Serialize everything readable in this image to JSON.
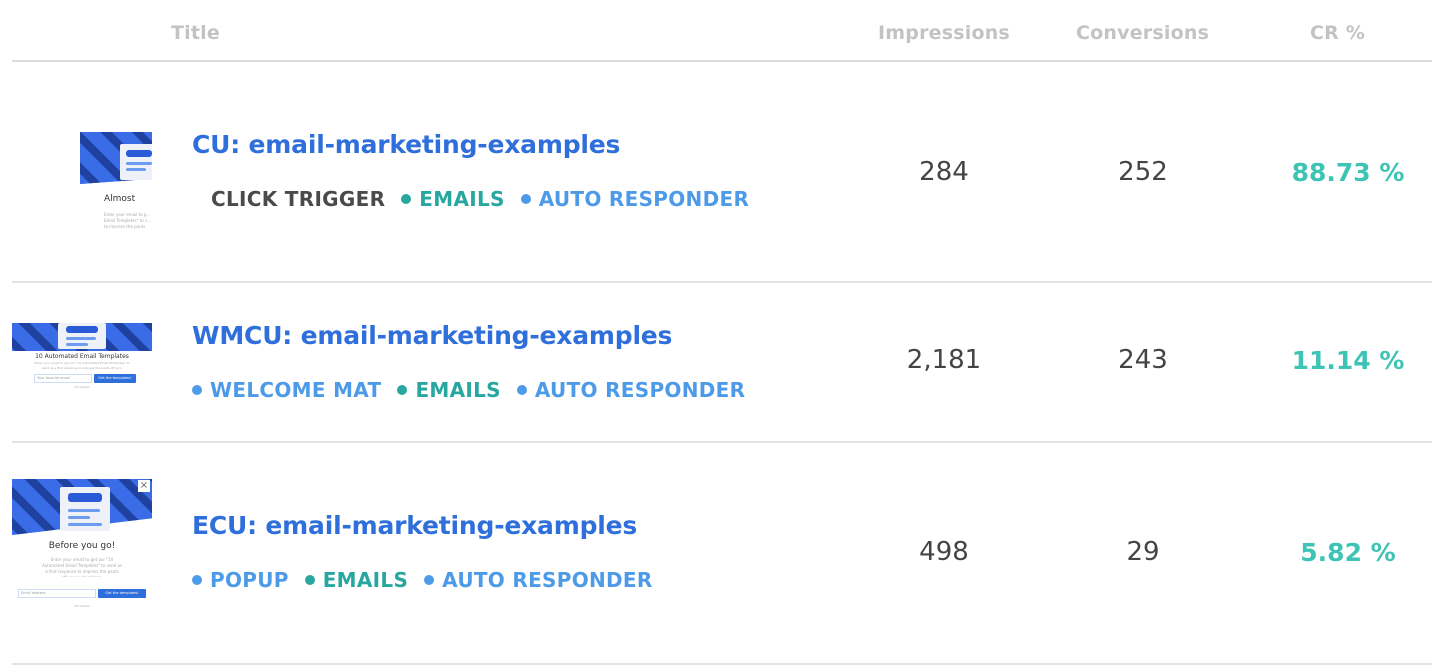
{
  "columns": {
    "title": "Title",
    "impressions": "Impressions",
    "conversions": "Conversions",
    "cr": "CR %"
  },
  "colors": {
    "title_link": "#2f6fdb",
    "tag_blue": "#4d9be8",
    "tag_teal": "#27a7a0",
    "tag_plain": "#4a4a4a",
    "cr_value": "#3ec4b4",
    "header_text": "#c3c3c3"
  },
  "rows": [
    {
      "title": "CU: email-marketing-examples",
      "tags": [
        {
          "label": "CLICK TRIGGER",
          "style": "plain",
          "dot": false
        },
        {
          "label": "EMAILS",
          "style": "teal",
          "dot": true
        },
        {
          "label": "AUTO RESPONDER",
          "style": "blue",
          "dot": true
        }
      ],
      "impressions": "284",
      "conversions": "252",
      "cr": "88.73 %",
      "thumbnail": {
        "icon": "campaign-preview-thumbnail",
        "heading": "Almost",
        "body": "Enter your email to g... Email Templates\" to s... to impress the pants"
      }
    },
    {
      "title": "WMCU: email-marketing-examples",
      "tags": [
        {
          "label": "WELCOME MAT",
          "style": "blue",
          "dot": true
        },
        {
          "label": "EMAILS",
          "style": "teal",
          "dot": true
        },
        {
          "label": "AUTO RESPONDER",
          "style": "blue",
          "dot": true
        }
      ],
      "impressions": "2,181",
      "conversions": "243",
      "cr": "11.14 %",
      "thumbnail": {
        "icon": "campaign-preview-thumbnail",
        "heading": "10 Automated Email Templates",
        "body": "Enter your email to get our \"10 Automated Email Templates\" to send as a first response to impress the pants off your subscribers.",
        "input_placeholder": "Your favorite email",
        "button": "Get the templates!",
        "dismiss": "No thanks"
      }
    },
    {
      "title": "ECU: email-marketing-examples",
      "tags": [
        {
          "label": "POPUP",
          "style": "blue",
          "dot": true
        },
        {
          "label": "EMAILS",
          "style": "teal",
          "dot": true
        },
        {
          "label": "AUTO RESPONDER",
          "style": "blue",
          "dot": true
        }
      ],
      "impressions": "498",
      "conversions": "29",
      "cr": "5.82 %",
      "thumbnail": {
        "icon": "campaign-preview-thumbnail",
        "heading": "Before you go!",
        "body": "Enter your email to get our \"10 Automated Email Templates\" to send as a first response to impress the pants off your subscribers.",
        "input_placeholder": "Email address",
        "button": "Get the templates!",
        "dismiss": "No thanks",
        "close": "×"
      }
    }
  ]
}
